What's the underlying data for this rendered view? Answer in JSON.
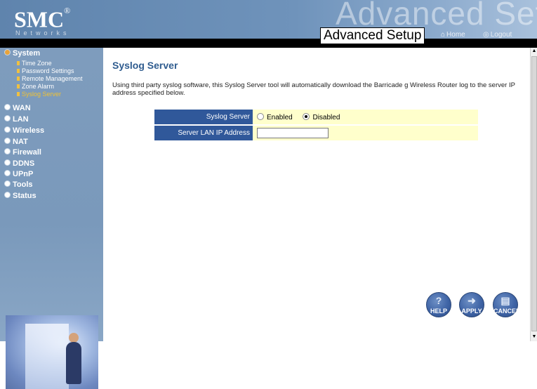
{
  "header": {
    "logo": "SMC",
    "logo_mark": "®",
    "logo_sub": "Networks",
    "bg_title": "Advanced Setup",
    "title": "Advanced Setup",
    "home_label": "Home",
    "logout_label": "Logout",
    "home_icon": "home-icon",
    "logout_icon": "logout-icon"
  },
  "sidebar": {
    "items": [
      {
        "label": "System",
        "active": true
      },
      {
        "label": "WAN"
      },
      {
        "label": "LAN"
      },
      {
        "label": "Wireless"
      },
      {
        "label": "NAT"
      },
      {
        "label": "Firewall"
      },
      {
        "label": "DDNS"
      },
      {
        "label": "UPnP"
      },
      {
        "label": "Tools"
      },
      {
        "label": "Status"
      }
    ],
    "system_sub": [
      {
        "label": "Time Zone"
      },
      {
        "label": "Password Settings"
      },
      {
        "label": "Remote Management"
      },
      {
        "label": "Zone Alarm"
      },
      {
        "label": "Syslog Server",
        "current": true
      }
    ]
  },
  "main": {
    "title": "Syslog Server",
    "description": "Using third party syslog software, this Syslog Server tool will automatically download the Barricade g Wireless Router log to the server IP address specified below.",
    "form": {
      "syslog_label": "Syslog Server",
      "enabled_label": "Enabled",
      "disabled_label": "Disabled",
      "selected": "Disabled",
      "ip_label": "Server LAN IP Address",
      "ip_value": ""
    },
    "buttons": {
      "help": "HELP",
      "apply": "APPLY",
      "cancel": "CANCEL"
    }
  },
  "colors": {
    "header_bg": "#5a7ea8",
    "sidebar_bg": "#7e9cbd",
    "title_color": "#2f5c8f",
    "label_bg": "#30589a",
    "value_bg": "#ffffcc",
    "current_submenu": "#f1c232"
  }
}
